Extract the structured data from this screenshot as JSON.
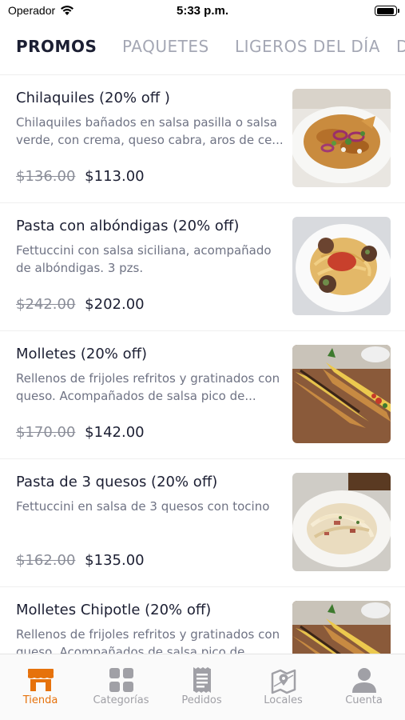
{
  "status_bar": {
    "carrier": "Operador",
    "time": "5:33 p.m.",
    "battery_level": 0.95
  },
  "tabs": [
    {
      "label": "PROMOS",
      "active": true
    },
    {
      "label": "PAQUETES",
      "active": false
    },
    {
      "label": "LIGEROS DEL DÍA",
      "active": false
    },
    {
      "label": "D",
      "active": false
    }
  ],
  "items": [
    {
      "title": "Chilaquiles (20% off )",
      "description": "Chilaquiles bañados en salsa pasilla o salsa verde, con crema, queso cabra, aros de ce...",
      "old_price": "$136.00",
      "price": "$113.00",
      "image": "chilaquiles-photo"
    },
    {
      "title": "Pasta con albóndigas (20% off)",
      "description": "Fettuccini con salsa siciliana, acompañado de albóndigas. 3 pzs.",
      "old_price": "$242.00",
      "price": "$202.00",
      "image": "pasta-meatballs-photo"
    },
    {
      "title": "Molletes (20% off)",
      "description": "Rellenos de frijoles refritos y gratinados con queso. Acompañados de salsa pico de...",
      "old_price": "$170.00",
      "price": "$142.00",
      "image": "molletes-photo"
    },
    {
      "title": "Pasta de 3 quesos (20% off)",
      "description": "Fettuccini en salsa de 3 quesos con tocino",
      "old_price": "$162.00",
      "price": "$135.00",
      "image": "pasta-cheese-photo"
    },
    {
      "title": "Molletes Chipotle (20% off)",
      "description": "Rellenos de frijoles refritos y gratinados con queso. Acompañados de salsa pico de...",
      "old_price": "",
      "price": "",
      "image": "molletes-chipotle-photo"
    }
  ],
  "bottom_nav": [
    {
      "label": "Tienda",
      "icon": "store-icon",
      "active": true
    },
    {
      "label": "Categorías",
      "icon": "grid-icon",
      "active": false
    },
    {
      "label": "Pedidos",
      "icon": "receipt-icon",
      "active": false
    },
    {
      "label": "Locales",
      "icon": "map-icon",
      "active": false
    },
    {
      "label": "Cuenta",
      "icon": "user-icon",
      "active": false
    }
  ],
  "colors": {
    "accent": "#e6720c",
    "inactive": "#a0a0a6",
    "text": "#1c1f33"
  }
}
